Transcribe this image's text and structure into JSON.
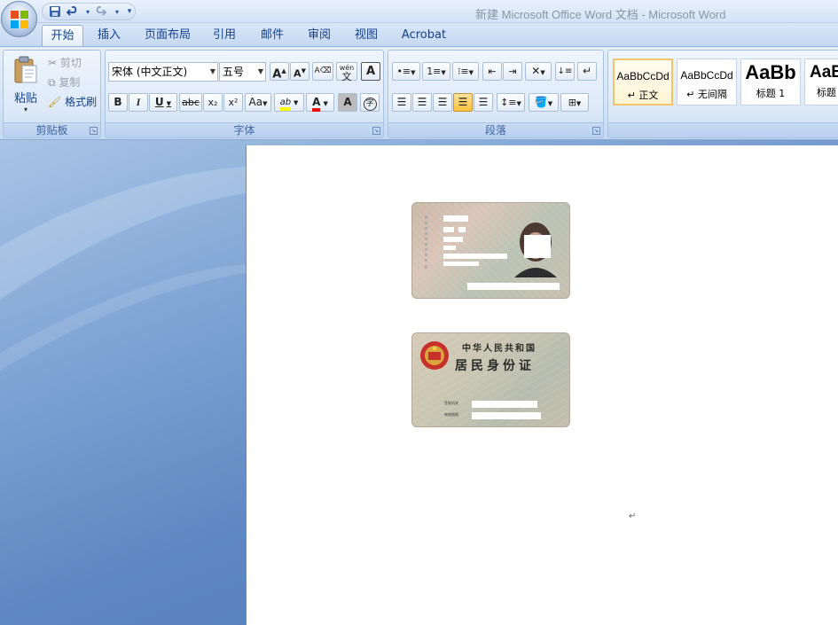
{
  "window": {
    "title": "新建 Microsoft Office Word 文档 - Microsoft Word"
  },
  "quick_access": {
    "save": "save-icon",
    "undo": "undo-icon",
    "redo": "redo-icon",
    "customize": "customize-icon"
  },
  "tabs": [
    {
      "label": "开始",
      "active": true
    },
    {
      "label": "插入"
    },
    {
      "label": "页面布局"
    },
    {
      "label": "引用"
    },
    {
      "label": "邮件"
    },
    {
      "label": "审阅"
    },
    {
      "label": "视图"
    },
    {
      "label": "Acrobat"
    }
  ],
  "clipboard": {
    "paste": "粘贴",
    "cut": "剪切",
    "copy": "复制",
    "format_painter": "格式刷",
    "group_label": "剪贴板"
  },
  "font": {
    "family": "宋体 (中文正文)",
    "size": "五号",
    "grow": "A",
    "shrink": "A",
    "phonetic": "wén",
    "phonetic_char": "文",
    "border_char": "A",
    "bold": "B",
    "italic": "I",
    "underline": "U",
    "strike": "abc",
    "subscript": "x₂",
    "superscript": "x²",
    "change_case": "Aa",
    "highlight": "ab",
    "font_color": "A",
    "shading": "A",
    "enclose": "字",
    "group_label": "字体"
  },
  "paragraph": {
    "group_label": "段落"
  },
  "styles": [
    {
      "sample": "AaBbCcDd",
      "name": "↵ 正文",
      "selected": true
    },
    {
      "sample": "AaBbCcDd",
      "name": "↵ 无间隔"
    },
    {
      "sample": "AaBb",
      "name": "标题 1"
    },
    {
      "sample": "AaB",
      "name": "标题"
    }
  ],
  "document": {
    "paragraph_mark": "↵",
    "id_card_back": {
      "line1": "中华人民共和国",
      "line2": "居民身份证",
      "issuer_label": "签发机关",
      "validity_label": "有效期限"
    }
  },
  "colors": {
    "highlight": "#ffff00",
    "font_color": "#e8110f",
    "accent": "#15428b"
  }
}
